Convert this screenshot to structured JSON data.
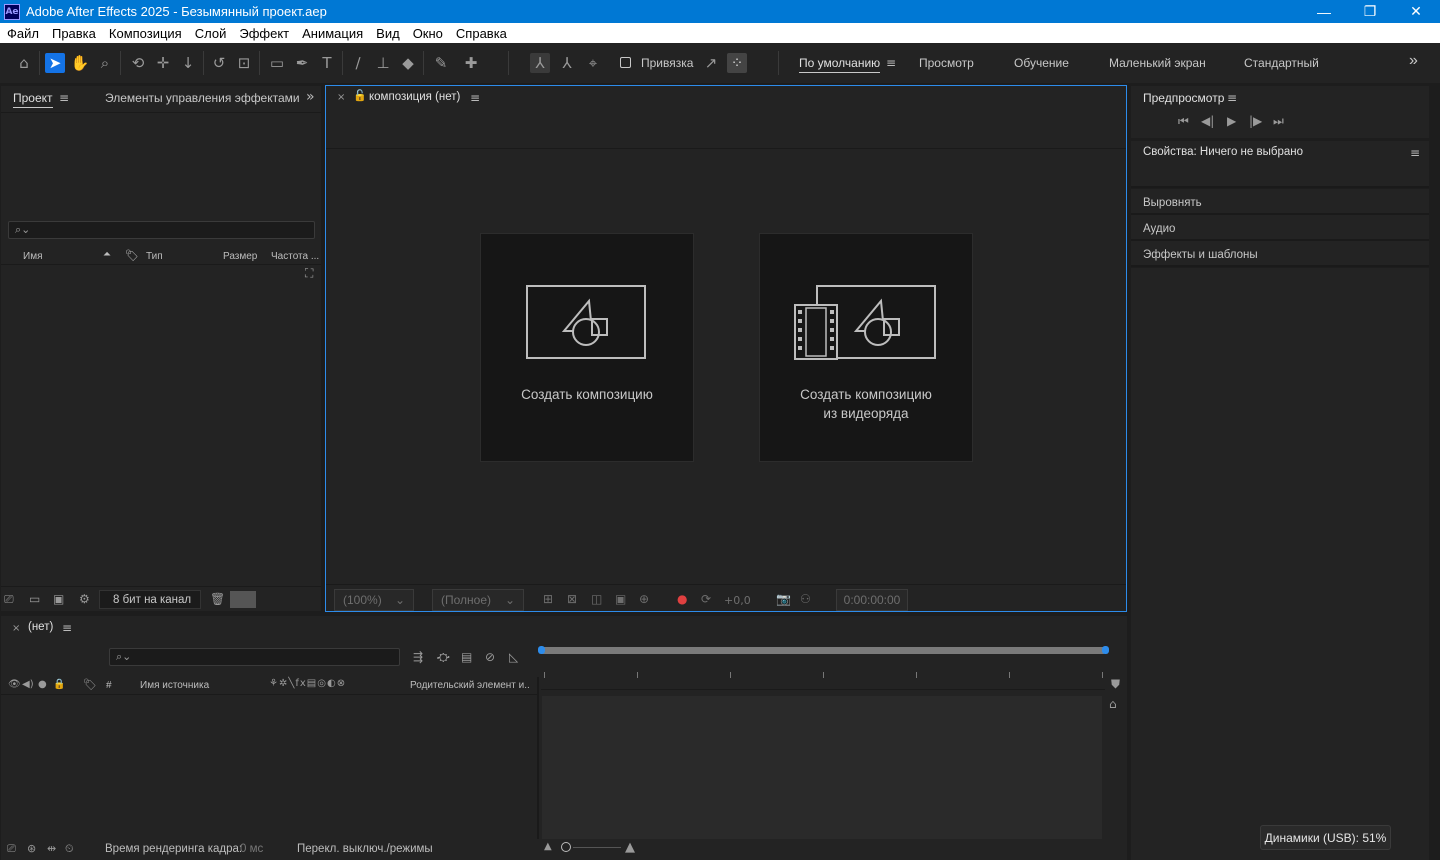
{
  "window": {
    "title": "Adobe After Effects 2025 - Безымянный проект.aep",
    "app_badge": "Ae",
    "minimize": "—",
    "restore": "❐",
    "close": "✕"
  },
  "menu": [
    "Файл",
    "Правка",
    "Композиция",
    "Слой",
    "Эффект",
    "Анимация",
    "Вид",
    "Окно",
    "Справка"
  ],
  "toolbar": {
    "snapping_label": "Привязка",
    "workspaces": [
      "По умолчанию",
      "Просмотр",
      "Обучение",
      "Маленький экран",
      "Стандартный"
    ],
    "active_workspace": "По умолчанию",
    "more": "»"
  },
  "project_panel": {
    "tab_project": "Проект",
    "tab_effects": "Элементы управления эффектами (нет",
    "columns": {
      "name": "Имя",
      "type": "Тип",
      "size": "Размер",
      "rate": "Частота ..."
    },
    "bit_depth": "8 бит на канал"
  },
  "viewer": {
    "tab_label": "композиция (нет)",
    "new_comp_label": "Создать композицию",
    "new_comp_footage_line1": "Создать композицию",
    "new_comp_footage_line2": "из видеоряда",
    "zoom": "(100%)",
    "resolution": "(Полное)",
    "exposure": "+0,0",
    "timecode": "0:00:00:00"
  },
  "right_panel": {
    "preview_title": "Предпросмотр",
    "properties_title": "Свойства: Ничего не выбрано",
    "align": "Выровнять",
    "audio": "Аудио",
    "effects": "Эффекты и шаблоны"
  },
  "timeline": {
    "tab_label": "(нет)",
    "col_source_name": "Имя источника",
    "col_parent": "Родительский элемент и...",
    "col_hash": "#",
    "render_time_label": "Время рендеринга кадра:",
    "render_time_value": "0 мс",
    "toggle_modes": "Перекл. выключ./режимы"
  },
  "tooltip": {
    "text": "Динамики (USB): 51%"
  },
  "colors": {
    "accent": "#2d8ceb",
    "title_bar": "#0078d4",
    "panel_bg": "#232323"
  }
}
